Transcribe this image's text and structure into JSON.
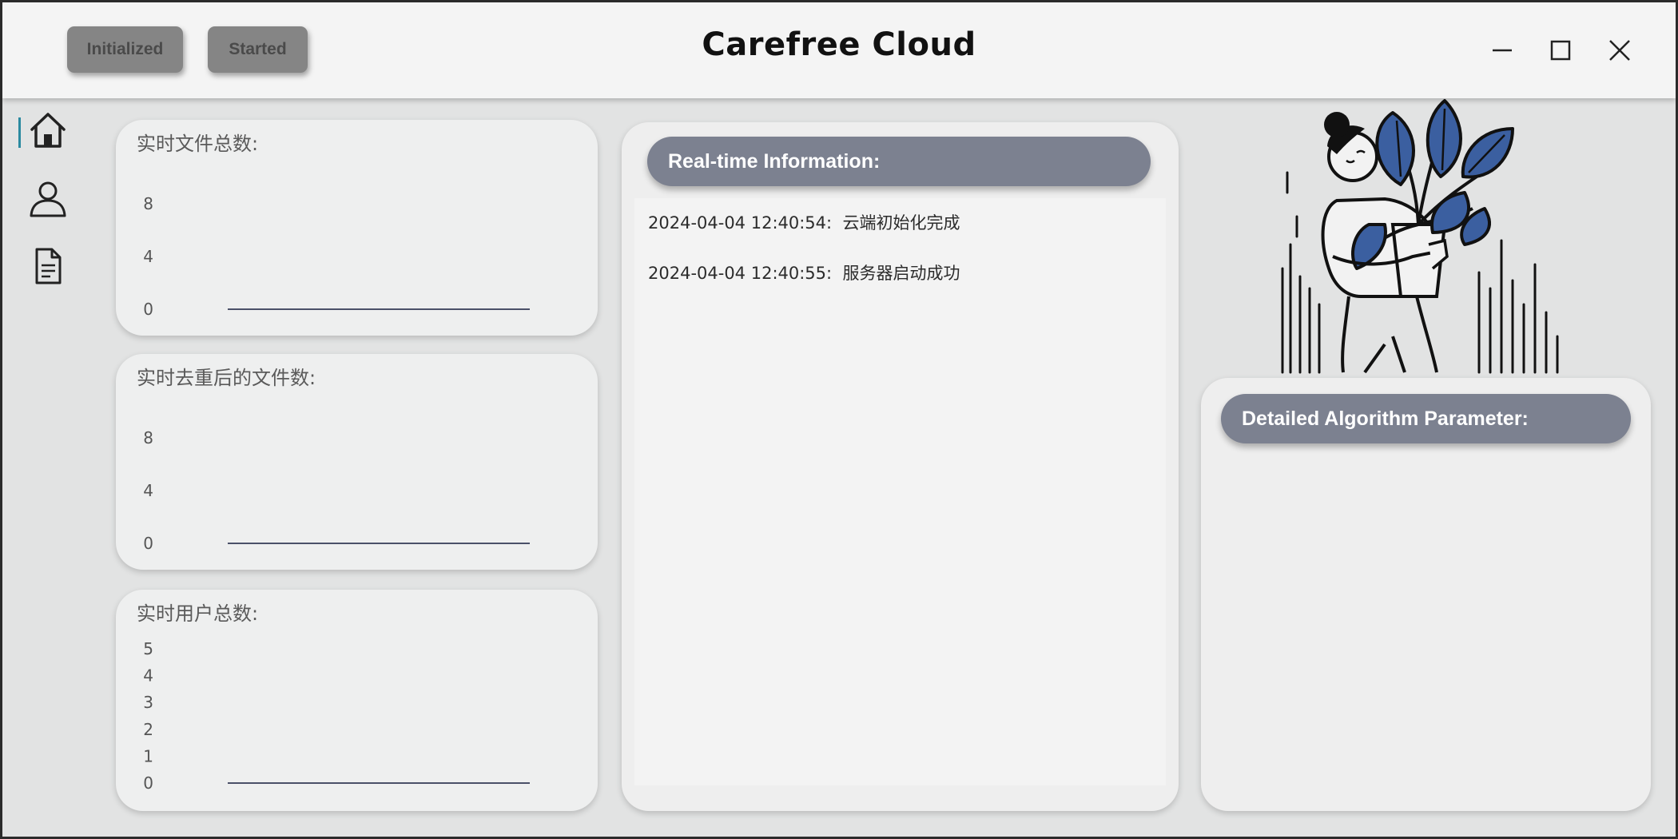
{
  "header": {
    "title": "Carefree Cloud",
    "status_buttons": [
      "Initialized",
      "Started"
    ],
    "window_controls": [
      "minimize-icon",
      "maximize-icon",
      "close-icon"
    ]
  },
  "nav": {
    "items": [
      {
        "name": "home",
        "icon": "home-icon",
        "active": true
      },
      {
        "name": "user",
        "icon": "user-icon",
        "active": false
      },
      {
        "name": "document",
        "icon": "document-icon",
        "active": false
      }
    ],
    "accent": "#2a8aa0"
  },
  "charts": [
    {
      "title": "实时文件总数:",
      "ticks": [
        "8",
        "4",
        "0"
      ]
    },
    {
      "title": "实时去重后的文件数:",
      "ticks": [
        "8",
        "4",
        "0"
      ]
    },
    {
      "title": "实时用户总数:",
      "ticks": [
        "5",
        "4",
        "3",
        "2",
        "1",
        "0"
      ]
    }
  ],
  "chart_data": [
    {
      "type": "line",
      "title": "实时文件总数:",
      "ylim": [
        0,
        8
      ],
      "yticks": [
        0,
        4,
        8
      ],
      "series": [
        {
          "values": [
            0,
            0
          ]
        }
      ]
    },
    {
      "type": "line",
      "title": "实时去重后的文件数:",
      "ylim": [
        0,
        8
      ],
      "yticks": [
        0,
        4,
        8
      ],
      "series": [
        {
          "values": [
            0,
            0
          ]
        }
      ]
    },
    {
      "type": "line",
      "title": "实时用户总数:",
      "ylim": [
        0,
        5
      ],
      "yticks": [
        0,
        1,
        2,
        3,
        4,
        5
      ],
      "series": [
        {
          "values": [
            0,
            0
          ]
        }
      ]
    }
  ],
  "realtime": {
    "header": "Real-time Information:",
    "logs": [
      {
        "time": "2024-04-04 12:40:54:",
        "message": "云端初始化完成"
      },
      {
        "time": "2024-04-04 12:40:55:",
        "message": "服务器启动成功"
      }
    ]
  },
  "algorithm": {
    "header": "Detailed Algorithm Parameter:"
  },
  "colors": {
    "header_pill": "#7c8190",
    "line": "#4a5068",
    "leaf": "#3b5fa0"
  }
}
